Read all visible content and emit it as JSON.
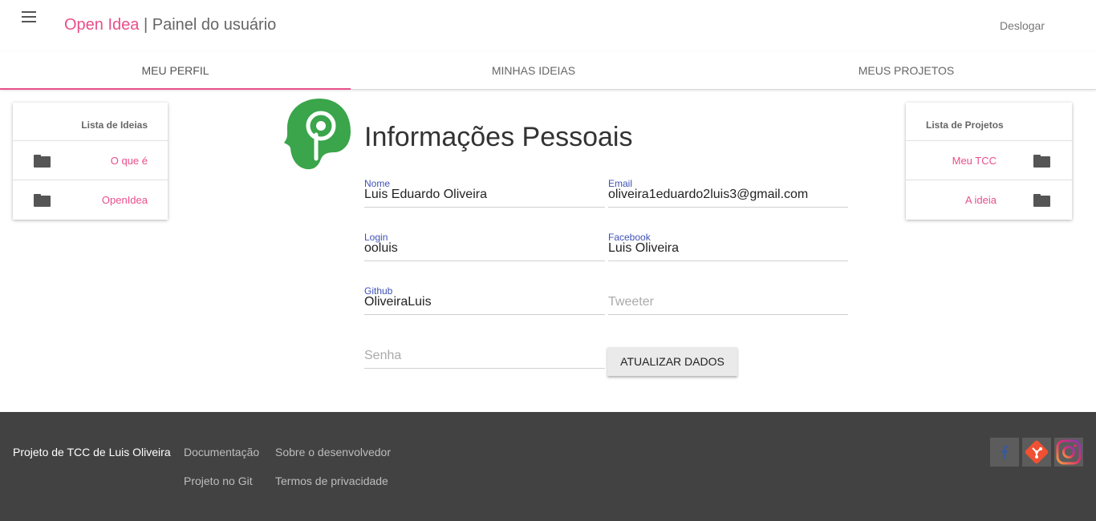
{
  "header": {
    "brand": "Open Idea",
    "separator": " | ",
    "subtitle": "Painel do usuário",
    "logout_label": "Deslogar"
  },
  "tabs": [
    {
      "label": "MEU PERFIL",
      "active": true
    },
    {
      "label": "MINHAS IDEIAS",
      "active": false
    },
    {
      "label": "MEUS PROJETOS",
      "active": false
    }
  ],
  "ideas_list": {
    "title": "Lista de Ideias",
    "items": [
      {
        "label": "O que é",
        "icon": "folder-icon"
      },
      {
        "label": "OpenIdea",
        "icon": "folder-icon"
      }
    ]
  },
  "projects_list": {
    "title": "Lista de Projetos",
    "items": [
      {
        "label": "Meu TCC",
        "icon": "folder-icon"
      },
      {
        "label": "A ideia",
        "icon": "folder-icon"
      }
    ]
  },
  "profile": {
    "title": "Informações Pessoais",
    "fields": {
      "name": {
        "label": "Nome",
        "value": "Luis Eduardo Oliveira"
      },
      "email": {
        "label": "Email",
        "value": "oliveira1eduardo2luis3@gmail.com"
      },
      "login": {
        "label": "Login",
        "value": "ooluis"
      },
      "facebook": {
        "label": "Facebook",
        "value": "Luis Oliveira"
      },
      "github": {
        "label": "Github",
        "value": "OliveiraLuis"
      },
      "tweeter": {
        "placeholder": "Tweeter"
      },
      "password": {
        "placeholder": "Senha"
      }
    },
    "update_button": "ATUALIZAR DADOS"
  },
  "footer": {
    "credit": "Projeto de TCC de Luis Oliveira",
    "links": [
      "Documentação",
      "Sobre o desenvolvedor",
      "Projeto no Git",
      "Termos de privacidade"
    ],
    "social": [
      "facebook-icon",
      "git-icon",
      "instagram-icon"
    ]
  },
  "colors": {
    "accent": "#e94e8a",
    "logo_green": "#3aa54a",
    "label_blue": "#3f51b5",
    "footer_bg": "#424242"
  }
}
